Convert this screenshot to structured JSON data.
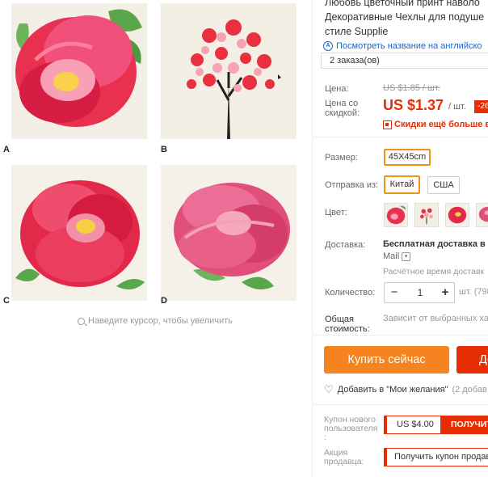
{
  "gallery": {
    "letters": [
      "A",
      "B",
      "C",
      "D"
    ],
    "zoom_hint": "Наведите курсор, чтобы увеличить"
  },
  "product": {
    "title_lines": [
      "Любовь цветочный принт наволо",
      "Декоративные Чехлы для подуше",
      "стиле Supplie"
    ],
    "translate_link": "Посмотреть название на английско",
    "orders": "2 заказа(ов)"
  },
  "price": {
    "label": "Цена:",
    "old": "US $1.85 / шт.",
    "discount_label": "Цена со скидкой:",
    "new": "US $1.37",
    "unit": "/ шт.",
    "discount_badge": "-26",
    "more_discounts": "Скидки ещё больше в п"
  },
  "options": {
    "size_label": "Размер:",
    "size_value": "45X45cm",
    "ship_from_label": "Отправка из:",
    "ship_from": [
      "Китай",
      "США"
    ],
    "color_label": "Цвет:"
  },
  "delivery": {
    "label": "Доставка:",
    "method": "Бесплатная доставка в R",
    "carrier": "Mail",
    "time": "Расчётное время доставк"
  },
  "quantity": {
    "label": "Количество:",
    "minus": "−",
    "value": "1",
    "plus": "+",
    "unit": "шт. (798"
  },
  "total": {
    "label": "Общая стоимость:",
    "value": "Зависит от выбранных хар"
  },
  "actions": {
    "buy_now": "Купить сейчас",
    "add_to_cart": "До",
    "wishlist": "Добавить в \"Мои желания\"",
    "wishlist_count": "(2 добав"
  },
  "coupons": {
    "new_user_label": "Купон нового пользователя :",
    "new_user_amount": "US $4.00",
    "new_user_get": "ПОЛУЧИТ",
    "seller_label": "Акция продавца:",
    "seller_get": "Получить купон продав"
  },
  "icons": {
    "zoom": "magnifier-icon",
    "translate": "translate-icon",
    "qr": "qr-icon",
    "wishlist": "heart-icon",
    "carrier_dropdown": "chevron-down-icon"
  },
  "colors": {
    "accent_red": "#e62e04",
    "accent_orange": "#f5831f",
    "selected_border": "#f09212",
    "link_blue": "#1a64c8"
  }
}
